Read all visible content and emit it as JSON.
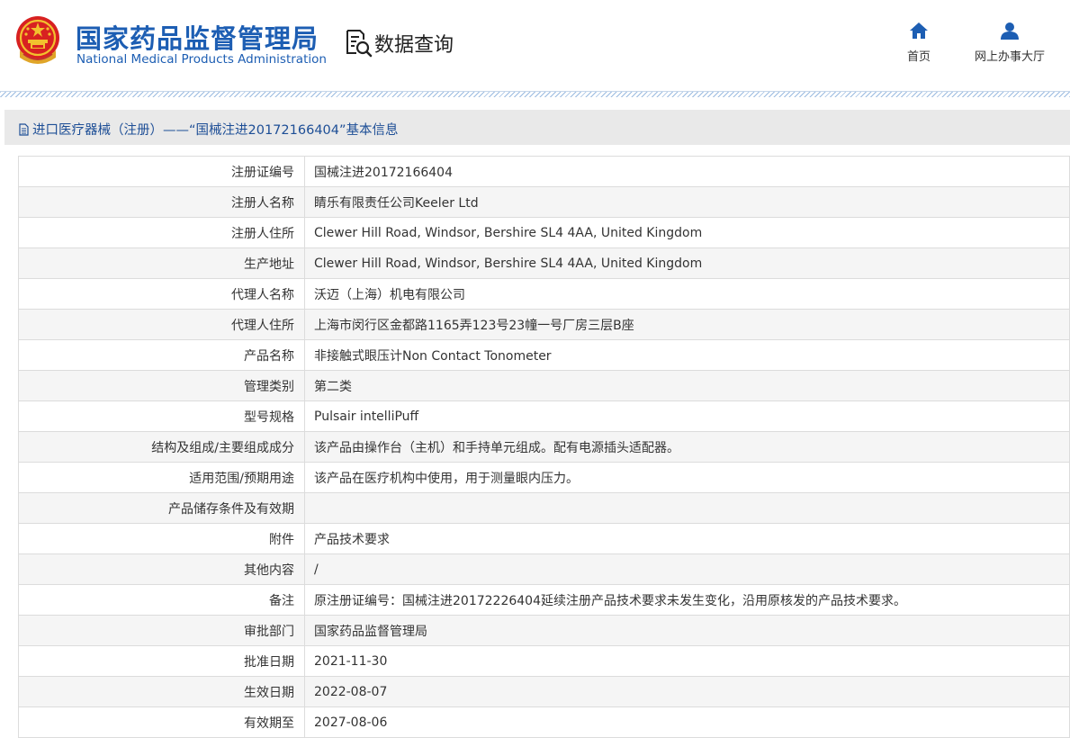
{
  "header": {
    "brand_cn": "国家药品监督管理局",
    "brand_en": "National Medical Products Administration",
    "query_label": "数据查询",
    "nav": [
      {
        "label": "首页",
        "icon": "home-icon"
      },
      {
        "label": "网上办事大厅",
        "icon": "user-icon"
      }
    ]
  },
  "section": {
    "title": "进口医疗器械（注册）——“国械注进20172166404”基本信息",
    "icon": "document-icon"
  },
  "table": {
    "rows": [
      {
        "label": "注册证编号",
        "value": "国械注进20172166404"
      },
      {
        "label": "注册人名称",
        "value": "睛乐有限责任公司Keeler Ltd"
      },
      {
        "label": "注册人住所",
        "value": "Clewer Hill Road, Windsor, Bershire SL4 4AA, United Kingdom"
      },
      {
        "label": "生产地址",
        "value": "Clewer Hill Road, Windsor, Bershire SL4 4AA, United Kingdom"
      },
      {
        "label": "代理人名称",
        "value": "沃迈（上海）机电有限公司"
      },
      {
        "label": "代理人住所",
        "value": "上海市闵行区金都路1165弄123号23幢一号厂房三层B座"
      },
      {
        "label": "产品名称",
        "value": "非接触式眼压计Non Contact Tonometer"
      },
      {
        "label": "管理类别",
        "value": "第二类"
      },
      {
        "label": "型号规格",
        "value": "Pulsair intelliPuff"
      },
      {
        "label": "结构及组成/主要组成成分",
        "value": "该产品由操作台（主机）和手持单元组成。配有电源插头适配器。"
      },
      {
        "label": "适用范围/预期用途",
        "value": "该产品在医疗机构中使用，用于测量眼内压力。"
      },
      {
        "label": "产品储存条件及有效期",
        "value": ""
      },
      {
        "label": "附件",
        "value": "产品技术要求"
      },
      {
        "label": "其他内容",
        "value": "/"
      },
      {
        "label": "备注",
        "value": "原注册证编号：国械注进20172226404延续注册产品技术要求未发生变化，沿用原核发的产品技术要求。"
      },
      {
        "label": "审批部门",
        "value": "国家药品监督管理局"
      },
      {
        "label": "批准日期",
        "value": "2021-11-30"
      },
      {
        "label": "生效日期",
        "value": "2022-08-07"
      },
      {
        "label": "有效期至",
        "value": "2027-08-06"
      }
    ]
  }
}
